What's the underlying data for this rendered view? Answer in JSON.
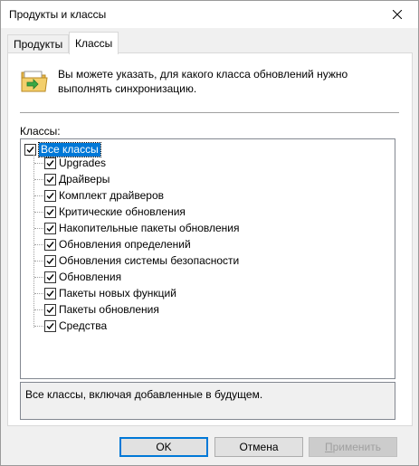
{
  "window": {
    "title": "Продукты и классы"
  },
  "tabs": [
    {
      "label": "Продукты",
      "active": false
    },
    {
      "label": "Классы",
      "active": true
    }
  ],
  "header": {
    "icon": "folder-sync-icon",
    "text": "Вы можете указать, для какого класса обновлений нужно выполнять синхронизацию."
  },
  "classes": {
    "label": "Классы:",
    "root": {
      "label": "Все классы",
      "checked": true,
      "selected": true
    },
    "items": [
      {
        "label": "Upgrades",
        "checked": true
      },
      {
        "label": "Драйверы",
        "checked": true
      },
      {
        "label": "Комплект драйверов",
        "checked": true
      },
      {
        "label": "Критические обновления",
        "checked": true
      },
      {
        "label": "Накопительные пакеты обновления",
        "checked": true
      },
      {
        "label": "Обновления определений",
        "checked": true
      },
      {
        "label": "Обновления системы безопасности",
        "checked": true
      },
      {
        "label": "Обновления",
        "checked": true
      },
      {
        "label": "Пакеты новых функций",
        "checked": true
      },
      {
        "label": "Пакеты обновления",
        "checked": true
      },
      {
        "label": "Средства",
        "checked": true
      }
    ]
  },
  "description": "Все классы, включая добавленные в будущем.",
  "buttons": {
    "ok": "OK",
    "cancel": "Отмена",
    "apply_first": "П",
    "apply_rest": "рименить",
    "apply_enabled": false
  },
  "colors": {
    "selection": "#0078d7",
    "default_button_border": "#0078d7"
  }
}
